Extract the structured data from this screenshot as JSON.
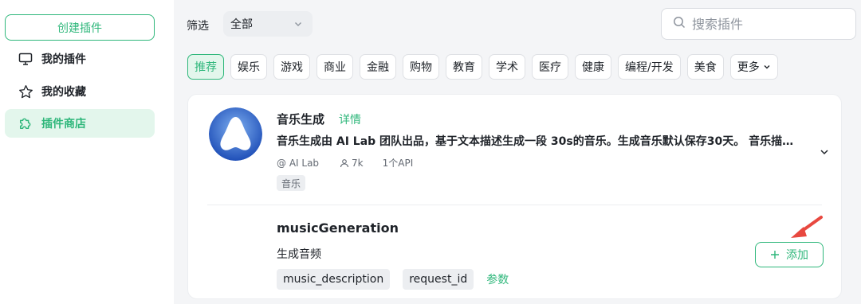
{
  "sidebar": {
    "create_label": "创建插件",
    "items": [
      {
        "label": "我的插件",
        "icon": "monitor-icon"
      },
      {
        "label": "我的收藏",
        "icon": "star-icon"
      },
      {
        "label": "插件商店",
        "icon": "puzzle-icon",
        "active": true
      }
    ]
  },
  "filter": {
    "label": "筛选",
    "selected": "全部"
  },
  "search": {
    "placeholder": "搜索插件"
  },
  "categories": [
    "推荐",
    "娱乐",
    "游戏",
    "商业",
    "金融",
    "购物",
    "教育",
    "学术",
    "医疗",
    "健康",
    "编程/开发",
    "美食",
    "更多"
  ],
  "plugin": {
    "title": "音乐生成",
    "detail_link": "详情",
    "description": "音乐生成由 AI Lab 团队出品，基于文本描述生成一段 30s的音乐。生成音乐默认保存30天。 音乐描述可以包含风格、情绪、乐器等信息",
    "author": "@ AI Lab",
    "users": "7k",
    "api_count": "1个API",
    "tag": "音乐",
    "api": {
      "name": "musicGeneration",
      "description": "生成音频",
      "params": [
        "music_description",
        "request_id"
      ],
      "params_link": "参数",
      "add_label": "添加"
    }
  },
  "colors": {
    "accent": "#2fb77b",
    "arrow": "#e8483f",
    "background": "#f4f5f7"
  }
}
